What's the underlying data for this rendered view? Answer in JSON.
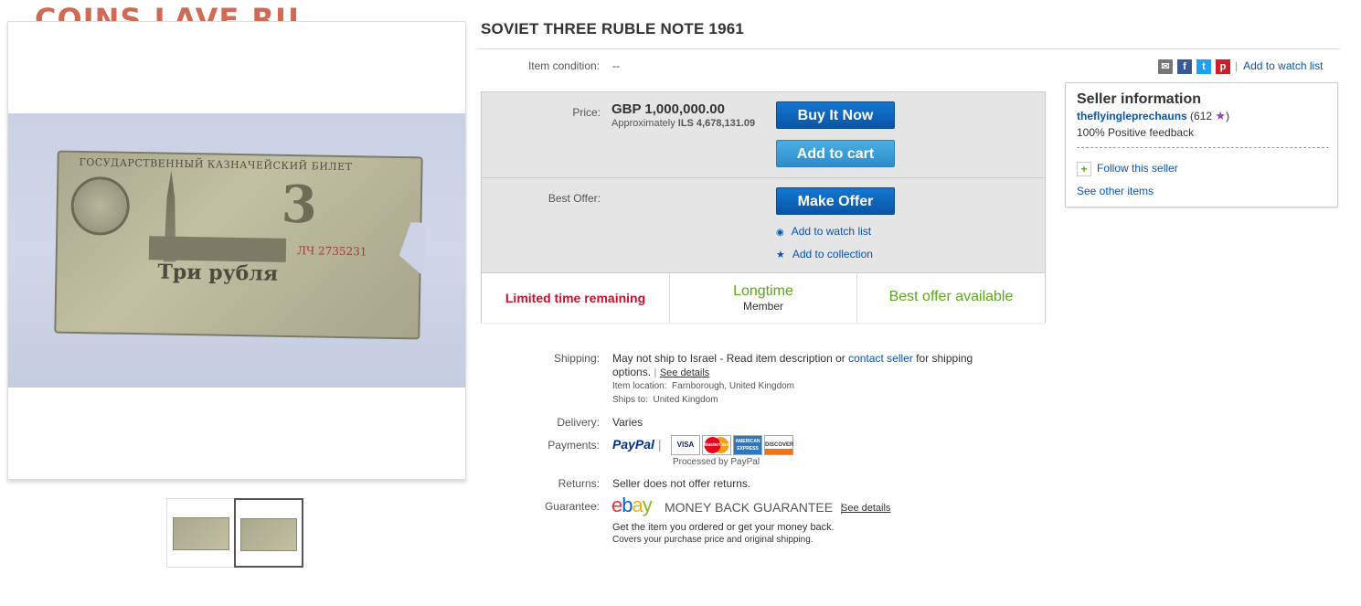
{
  "watermark": "COINS.LAVE.RU",
  "title": "SOVIET THREE RUBLE NOTE 1961",
  "condition": {
    "label": "Item condition:",
    "value": "--"
  },
  "share": {
    "watch_link": "Add to watch list",
    "icons": [
      "email-icon",
      "facebook-icon",
      "twitter-icon",
      "pinterest-icon"
    ]
  },
  "price": {
    "label": "Price:",
    "value": "GBP 1,000,000.00",
    "approx_prefix": "Approximately",
    "approx_value": "ILS 4,678,131.09",
    "buy_now": "Buy It Now",
    "add_to_cart": "Add to cart"
  },
  "offer": {
    "label": "Best Offer:",
    "make_offer": "Make Offer",
    "watch": "Add to watch list",
    "collection": "Add to collection"
  },
  "strip": {
    "limited": "Limited time remaining",
    "longtime": "Longtime",
    "member": "Member",
    "best_offer": "Best offer available"
  },
  "seller": {
    "heading": "Seller information",
    "name": "theflyingleprechauns",
    "score_open": "(612",
    "score_close": ")",
    "feedback": "100% Positive feedback",
    "follow": "Follow this seller",
    "other": "See other items"
  },
  "shipping": {
    "label": "Shipping:",
    "text1": "May not ship to Israel - Read item description or",
    "contact": "contact seller",
    "text2": "for shipping",
    "text3": "options.",
    "see_details": "See details",
    "location_label": "Item location:",
    "location": "Farnborough, United Kingdom",
    "ships_label": "Ships to:",
    "ships": "United Kingdom"
  },
  "delivery": {
    "label": "Delivery:",
    "value": "Varies"
  },
  "payments": {
    "label": "Payments:",
    "paypal": "PayPal",
    "cards": [
      "VISA",
      "MasterCard",
      "AMERICAN EXPRESS",
      "DISCOVER"
    ],
    "processed": "Processed by PayPal"
  },
  "returns": {
    "label": "Returns:",
    "value": "Seller does not offer returns."
  },
  "guarantee": {
    "label": "Guarantee:",
    "brand_e": "e",
    "brand_b": "b",
    "brand_a": "a",
    "brand_y": "y",
    "mbg": "MONEY BACK GUARANTEE",
    "see_details": "See details",
    "line1": "Get the item you ordered or get your money back.",
    "line2": "Covers your purchase price and original shipping."
  },
  "banknote": {
    "header": "ГОСУДАРСТВЕННЫЙ КАЗНАЧЕЙСКИЙ БИЛЕТ",
    "numeral": "3",
    "serial": "ЛЧ 2735231",
    "words": "Три рубля"
  },
  "colors": {
    "brand_red": "#e53238",
    "brand_blue": "#0064d2",
    "brand_yellow": "#f5af02",
    "brand_green": "#86b817",
    "limited_red": "#c8102e",
    "green_text": "#5ba71b"
  }
}
